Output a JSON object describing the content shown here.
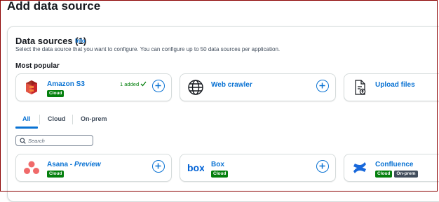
{
  "page": {
    "title": "Add data source"
  },
  "header": {
    "title": "Data sources (1)",
    "info": "Info",
    "description": "Select the data source that you want to configure. You can configure up to 50 data sources per application."
  },
  "most_popular": {
    "title": "Most popular",
    "cards": [
      {
        "name": "Amazon S3",
        "badges": [
          "Cloud"
        ],
        "status": "1 added",
        "icon": "amazon-s3-icon"
      },
      {
        "name": "Web crawler",
        "badges": [],
        "icon": "globe-icon"
      },
      {
        "name": "Upload files",
        "badges": [],
        "icon": "file-upload-icon"
      }
    ]
  },
  "tabs": [
    "All",
    "Cloud",
    "On-prem"
  ],
  "active_tab": "All",
  "search": {
    "placeholder": "Search"
  },
  "sources": [
    {
      "name": "Asana",
      "suffix": " - Preview",
      "badges": [
        "Cloud"
      ],
      "icon": "asana-icon"
    },
    {
      "name": "Box",
      "badges": [
        "Cloud"
      ],
      "icon": "box-icon"
    },
    {
      "name": "Confluence",
      "badges": [
        "Cloud",
        "On-prem"
      ],
      "icon": "confluence-icon"
    }
  ],
  "colors": {
    "link": "#0972d3",
    "cloud_badge": "#037f0c",
    "onprem_badge": "#414d5c",
    "success": "#037f0c",
    "frame": "#8b0000"
  }
}
